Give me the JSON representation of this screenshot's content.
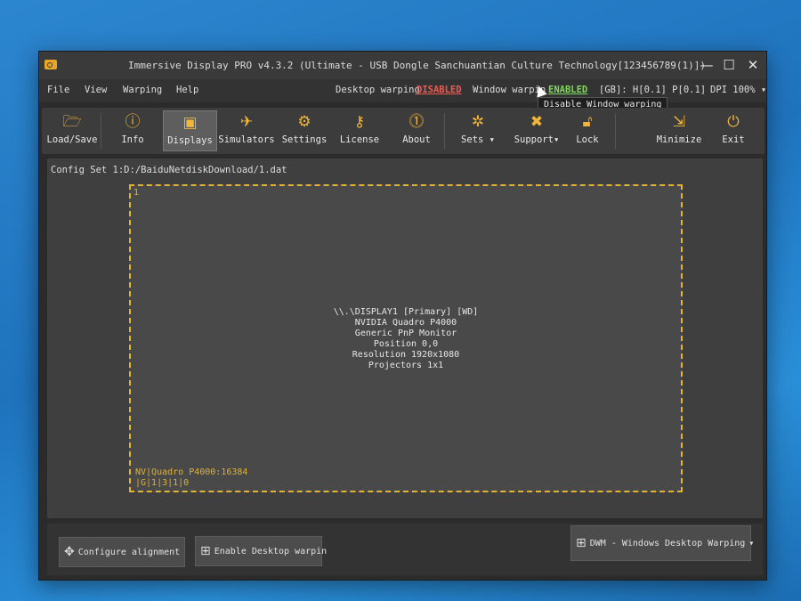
{
  "window": {
    "title": "Immersive Display PRO v4.3.2 (Ultimate - USB Dongle Sanchuantian Culture Technology[123456789(1)])"
  },
  "menu": {
    "items": [
      "File",
      "View",
      "Warping",
      "Help"
    ],
    "desktop_warping_label": "Desktop warping",
    "desktop_warping_state": "DISABLED",
    "window_warping_label": "Window warpin",
    "window_warping_state": "ENABLED",
    "gb_label": "[GB]: H[0.1] P[0.1]",
    "dpi_label": "DPI 100%"
  },
  "tooltip": "Disable Window warping",
  "toolbar": {
    "load_save": "Load/Save",
    "info": "Info",
    "displays": "Displays",
    "simulators": "Simulators",
    "settings": "Settings",
    "license": "License",
    "about": "About",
    "sets": "Sets",
    "support": "Support",
    "lock": "Lock",
    "minimize": "Minimize",
    "exit": "Exit"
  },
  "config_set": "Config Set 1:D:/BaiduNetdiskDownload/1.dat",
  "display": {
    "number": "1",
    "info_lines": [
      "\\\\.\\DISPLAY1 [Primary] [WD]",
      "NVIDIA Quadro P4000",
      "Generic PnP Monitor",
      "Position 0,0",
      "Resolution 1920x1080",
      "Projectors 1x1"
    ],
    "footer_line1": "NV|Quadro P4000:16384",
    "footer_line2": "|G|1|3|1|0"
  },
  "bottom": {
    "configure_alignment": "Configure alignment",
    "enable_desktop_warping": "Enable Desktop warpin",
    "dwm_select": "DWM - Windows Desktop Warping"
  },
  "colors": {
    "accent": "#e0b236",
    "disabled": "#f05a4f",
    "enabled": "#7dd85b"
  }
}
